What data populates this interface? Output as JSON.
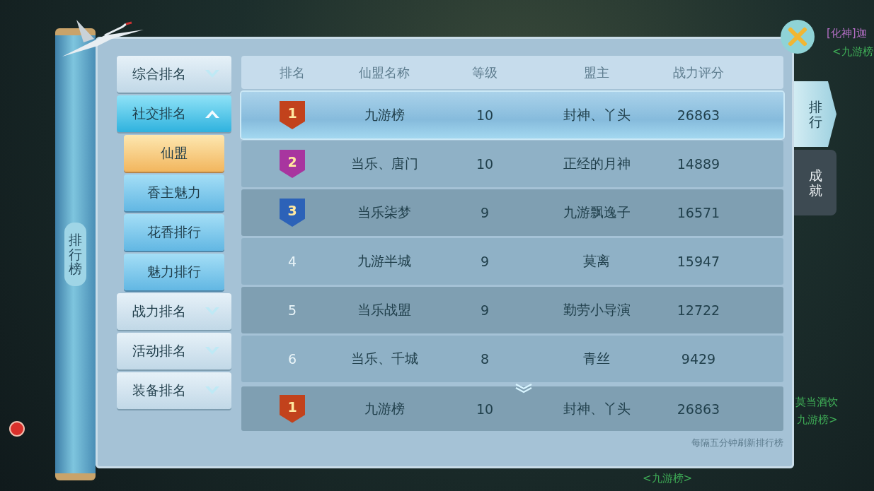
{
  "scene_labels": [
    {
      "text": "[化神]迦",
      "kind": "guild"
    },
    {
      "text": "<九游榜",
      "kind": "name"
    },
    {
      "text": "莫当酒饮",
      "kind": "name"
    },
    {
      "text": "九游榜>",
      "kind": "name"
    },
    {
      "text": "<九游榜>",
      "kind": "name"
    }
  ],
  "scroll": {
    "title": "排行榜"
  },
  "menu": [
    {
      "label": "综合排名",
      "expanded": false
    },
    {
      "label": "社交排名",
      "expanded": true,
      "children": [
        {
          "label": "仙盟",
          "selected": true
        },
        {
          "label": "香主魅力",
          "selected": false
        },
        {
          "label": "花香排行",
          "selected": false
        },
        {
          "label": "魅力排行",
          "selected": false
        }
      ]
    },
    {
      "label": "战力排名",
      "expanded": false
    },
    {
      "label": "活动排名",
      "expanded": false
    },
    {
      "label": "装备排名",
      "expanded": false
    }
  ],
  "table": {
    "columns": [
      "排名",
      "仙盟名称",
      "等级",
      "盟主",
      "战力评分"
    ],
    "rows": [
      {
        "rank": "1",
        "kind": "badge",
        "color": "#c2421c",
        "name": "九游榜",
        "level": "10",
        "leader": "封神、丫头",
        "score": "26863",
        "selected": true
      },
      {
        "rank": "2",
        "kind": "badge",
        "color": "#a8359f",
        "name": "当乐、唐门",
        "level": "10",
        "leader": "正经的月神",
        "score": "14889",
        "selected": false
      },
      {
        "rank": "3",
        "kind": "badge",
        "color": "#2c62b8",
        "name": "当乐柒梦",
        "level": "9",
        "leader": "九游飘逸子",
        "score": "16571",
        "selected": false
      },
      {
        "rank": "4",
        "kind": "plain",
        "name": "九游半城",
        "level": "9",
        "leader": "莫离",
        "score": "15947",
        "selected": false
      },
      {
        "rank": "5",
        "kind": "plain",
        "name": "当乐战盟",
        "level": "9",
        "leader": "勤劳小导演",
        "score": "12722",
        "selected": false
      },
      {
        "rank": "6",
        "kind": "plain",
        "name": "当乐、千城",
        "level": "8",
        "leader": "青丝",
        "score": "9429",
        "selected": false
      }
    ],
    "own_row": {
      "rank": "1",
      "kind": "badge",
      "color": "#c2421c",
      "name": "九游榜",
      "level": "10",
      "leader": "封神、丫头",
      "score": "26863"
    }
  },
  "footer_note": "每隔五分钟刷新排行榜",
  "side_tabs": [
    {
      "label": "排行",
      "selected": true
    },
    {
      "label": "成就",
      "selected": false
    }
  ]
}
